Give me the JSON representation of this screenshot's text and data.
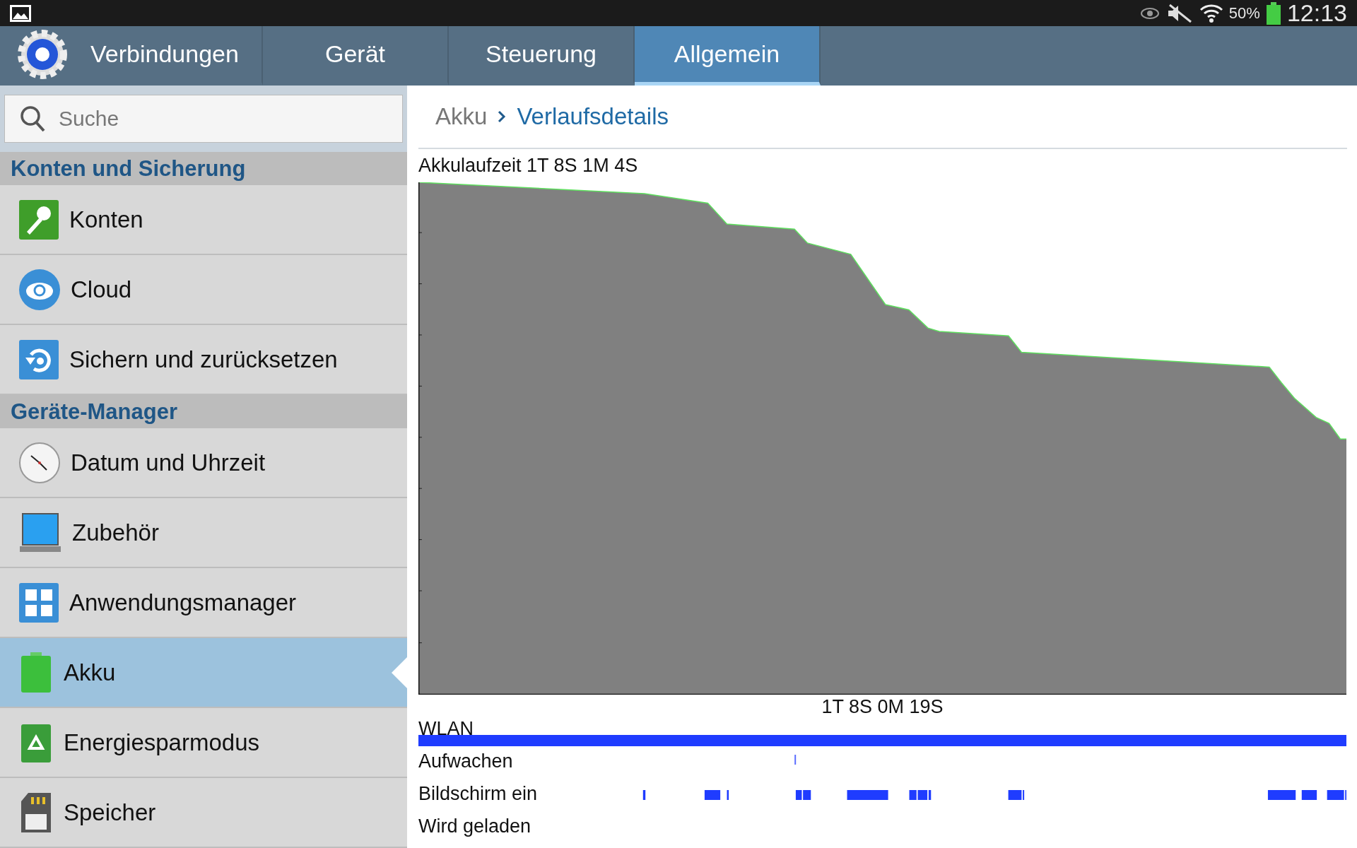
{
  "status_bar": {
    "battery": "50%",
    "time": "12:13"
  },
  "tabs": [
    {
      "label": "Verbindungen",
      "selected": false
    },
    {
      "label": "Gerät",
      "selected": false
    },
    {
      "label": "Steuerung",
      "selected": false
    },
    {
      "label": "Allgemein",
      "selected": true
    }
  ],
  "search": {
    "placeholder": "Suche"
  },
  "sidebar": {
    "sections": [
      {
        "title": "Konten und Sicherung",
        "items": [
          {
            "label": "Konten",
            "selected": false
          },
          {
            "label": "Cloud",
            "selected": false
          },
          {
            "label": "Sichern und zurücksetzen",
            "selected": false
          }
        ]
      },
      {
        "title": "Geräte-Manager",
        "items": [
          {
            "label": "Datum und Uhrzeit",
            "selected": false
          },
          {
            "label": "Zubehör",
            "selected": false
          },
          {
            "label": "Anwendungsmanager",
            "selected": false
          },
          {
            "label": "Akku",
            "selected": true
          },
          {
            "label": "Energiesparmodus",
            "selected": false
          },
          {
            "label": "Speicher",
            "selected": false
          }
        ]
      }
    ]
  },
  "breadcrumb": {
    "parent": "Akku",
    "current": "Verlaufsdetails"
  },
  "graph": {
    "title": "Akkulaufzeit 1T 8S 1M 4S",
    "duration": "1T 8S 0M 19S"
  },
  "timelines": [
    {
      "label": "WLAN",
      "kind": "wlan"
    },
    {
      "label": "Aufwachen",
      "kind": "wake"
    },
    {
      "label": "Bildschirm ein",
      "kind": "screen"
    },
    {
      "label": "Wird geladen",
      "kind": "charge"
    }
  ]
}
